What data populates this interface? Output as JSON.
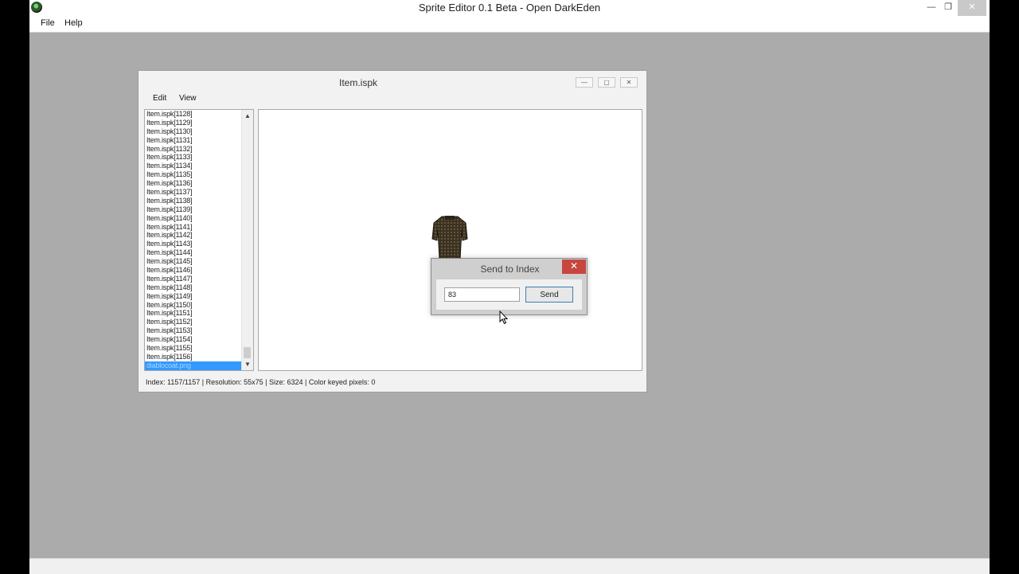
{
  "app": {
    "title": "Sprite Editor 0.1 Beta - Open DarkEden",
    "icon": "app-icon",
    "controls": {
      "minimize": "—",
      "restore": "❐",
      "close": "✕"
    },
    "menu": [
      "File",
      "Help"
    ]
  },
  "child_window": {
    "title": "Item.ispk",
    "controls": {
      "minimize": "—",
      "maximize": "▢",
      "close": "✕"
    },
    "menu": [
      "Edit",
      "View"
    ],
    "list_items": [
      "Item.ispk[1128]",
      "Item.ispk[1129]",
      "Item.ispk[1130]",
      "Item.ispk[1131]",
      "Item.ispk[1132]",
      "Item.ispk[1133]",
      "Item.ispk[1134]",
      "Item.ispk[1135]",
      "Item.ispk[1136]",
      "Item.ispk[1137]",
      "Item.ispk[1138]",
      "Item.ispk[1139]",
      "Item.ispk[1140]",
      "Item.ispk[1141]",
      "Item.ispk[1142]",
      "Item.ispk[1143]",
      "Item.ispk[1144]",
      "Item.ispk[1145]",
      "Item.ispk[1146]",
      "Item.ispk[1147]",
      "Item.ispk[1148]",
      "Item.ispk[1149]",
      "Item.ispk[1150]",
      "Item.ispk[1151]",
      "Item.ispk[1152]",
      "Item.ispk[1153]",
      "Item.ispk[1154]",
      "Item.ispk[1155]",
      "Item.ispk[1156]",
      "diablocoat.png"
    ],
    "selected_item": "diablocoat.png",
    "status": "Index: 1157/1157 | Resolution: 55x75 | Size: 6324 | Color keyed pixels: 0"
  },
  "dialog": {
    "title": "Send to Index",
    "close": "✕",
    "input_value": "83",
    "send_label": "Send"
  },
  "colors": {
    "selection": "#3399ff",
    "workspace": "#ababab",
    "dialog_close": "#c7463d"
  }
}
